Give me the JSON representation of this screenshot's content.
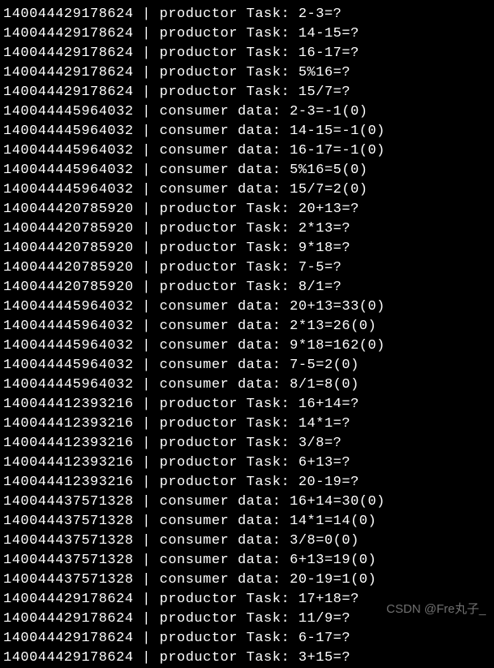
{
  "lines": [
    {
      "tid": "140044429178624",
      "role": "productor",
      "text": "2-3=?"
    },
    {
      "tid": "140044429178624",
      "role": "productor",
      "text": "14-15=?"
    },
    {
      "tid": "140044429178624",
      "role": "productor",
      "text": "16-17=?"
    },
    {
      "tid": "140044429178624",
      "role": "productor",
      "text": "5%16=?"
    },
    {
      "tid": "140044429178624",
      "role": "productor",
      "text": "15/7=?"
    },
    {
      "tid": "140044445964032",
      "role": "consumer",
      "text": "2-3=-1(0)"
    },
    {
      "tid": "140044445964032",
      "role": "consumer",
      "text": "14-15=-1(0)"
    },
    {
      "tid": "140044445964032",
      "role": "consumer",
      "text": "16-17=-1(0)"
    },
    {
      "tid": "140044445964032",
      "role": "consumer",
      "text": "5%16=5(0)"
    },
    {
      "tid": "140044445964032",
      "role": "consumer",
      "text": "15/7=2(0)"
    },
    {
      "tid": "140044420785920",
      "role": "productor",
      "text": "20+13=?"
    },
    {
      "tid": "140044420785920",
      "role": "productor",
      "text": "2*13=?"
    },
    {
      "tid": "140044420785920",
      "role": "productor",
      "text": "9*18=?"
    },
    {
      "tid": "140044420785920",
      "role": "productor",
      "text": "7-5=?"
    },
    {
      "tid": "140044420785920",
      "role": "productor",
      "text": "8/1=?"
    },
    {
      "tid": "140044445964032",
      "role": "consumer",
      "text": "20+13=33(0)"
    },
    {
      "tid": "140044445964032",
      "role": "consumer",
      "text": "2*13=26(0)"
    },
    {
      "tid": "140044445964032",
      "role": "consumer",
      "text": "9*18=162(0)"
    },
    {
      "tid": "140044445964032",
      "role": "consumer",
      "text": "7-5=2(0)"
    },
    {
      "tid": "140044445964032",
      "role": "consumer",
      "text": "8/1=8(0)"
    },
    {
      "tid": "140044412393216",
      "role": "productor",
      "text": "16+14=?"
    },
    {
      "tid": "140044412393216",
      "role": "productor",
      "text": "14*1=?"
    },
    {
      "tid": "140044412393216",
      "role": "productor",
      "text": "3/8=?"
    },
    {
      "tid": "140044412393216",
      "role": "productor",
      "text": "6+13=?"
    },
    {
      "tid": "140044412393216",
      "role": "productor",
      "text": "20-19=?"
    },
    {
      "tid": "140044437571328",
      "role": "consumer",
      "text": "16+14=30(0)"
    },
    {
      "tid": "140044437571328",
      "role": "consumer",
      "text": "14*1=14(0)"
    },
    {
      "tid": "140044437571328",
      "role": "consumer",
      "text": "3/8=0(0)"
    },
    {
      "tid": "140044437571328",
      "role": "consumer",
      "text": "6+13=19(0)"
    },
    {
      "tid": "140044437571328",
      "role": "consumer",
      "text": "20-19=1(0)"
    },
    {
      "tid": "140044429178624",
      "role": "productor",
      "text": "17+18=?"
    },
    {
      "tid": "140044429178624",
      "role": "productor",
      "text": "11/9=?"
    },
    {
      "tid": "140044429178624",
      "role": "productor",
      "text": "6-17=?"
    },
    {
      "tid": "140044429178624",
      "role": "productor",
      "text": "3+15=?"
    }
  ],
  "watermark": "CSDN @Fre丸子_"
}
